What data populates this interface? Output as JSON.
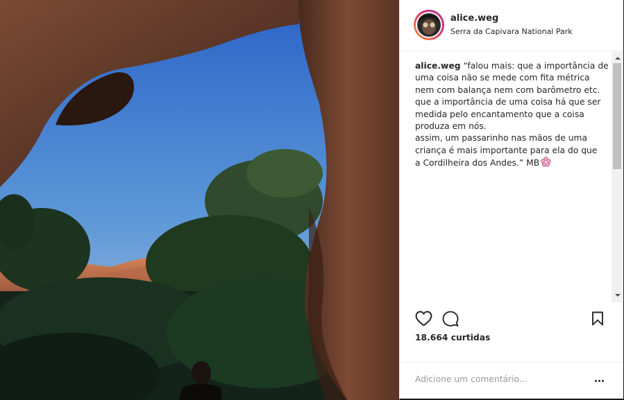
{
  "post": {
    "username": "alice.weg",
    "location": "Serra da Capivara National Park",
    "caption": {
      "user": "alice.weg",
      "lines": [
        "“falou mais: que a importância de",
        "uma coisa não se mede com fita métrica",
        "nem com balança nem com barômetro etc.",
        "que a importância de uma coisa há que ser",
        "medida pelo encantamento que a coisa",
        "produza em nós.",
        "assim, um passarinho nas mãos de uma",
        "criança é mais importante para ela do que",
        "a Cordilheira dos Andes.” MB"
      ]
    },
    "likes_count": "18.664",
    "likes_label": "curtidas",
    "comment_placeholder": "Adicione um comentário..."
  },
  "icons": {
    "like": "heart-outline-icon",
    "comment": "speech-bubble-icon",
    "save": "bookmark-outline-icon",
    "more": "ellipsis-icon",
    "emoji": "cherry-blossom-icon"
  },
  "colors": {
    "avatar_ring_start": "#f9a03a",
    "avatar_ring_end": "#a6339a",
    "text": "#262626",
    "muted": "#999999",
    "flower": "#f1a7c6"
  }
}
